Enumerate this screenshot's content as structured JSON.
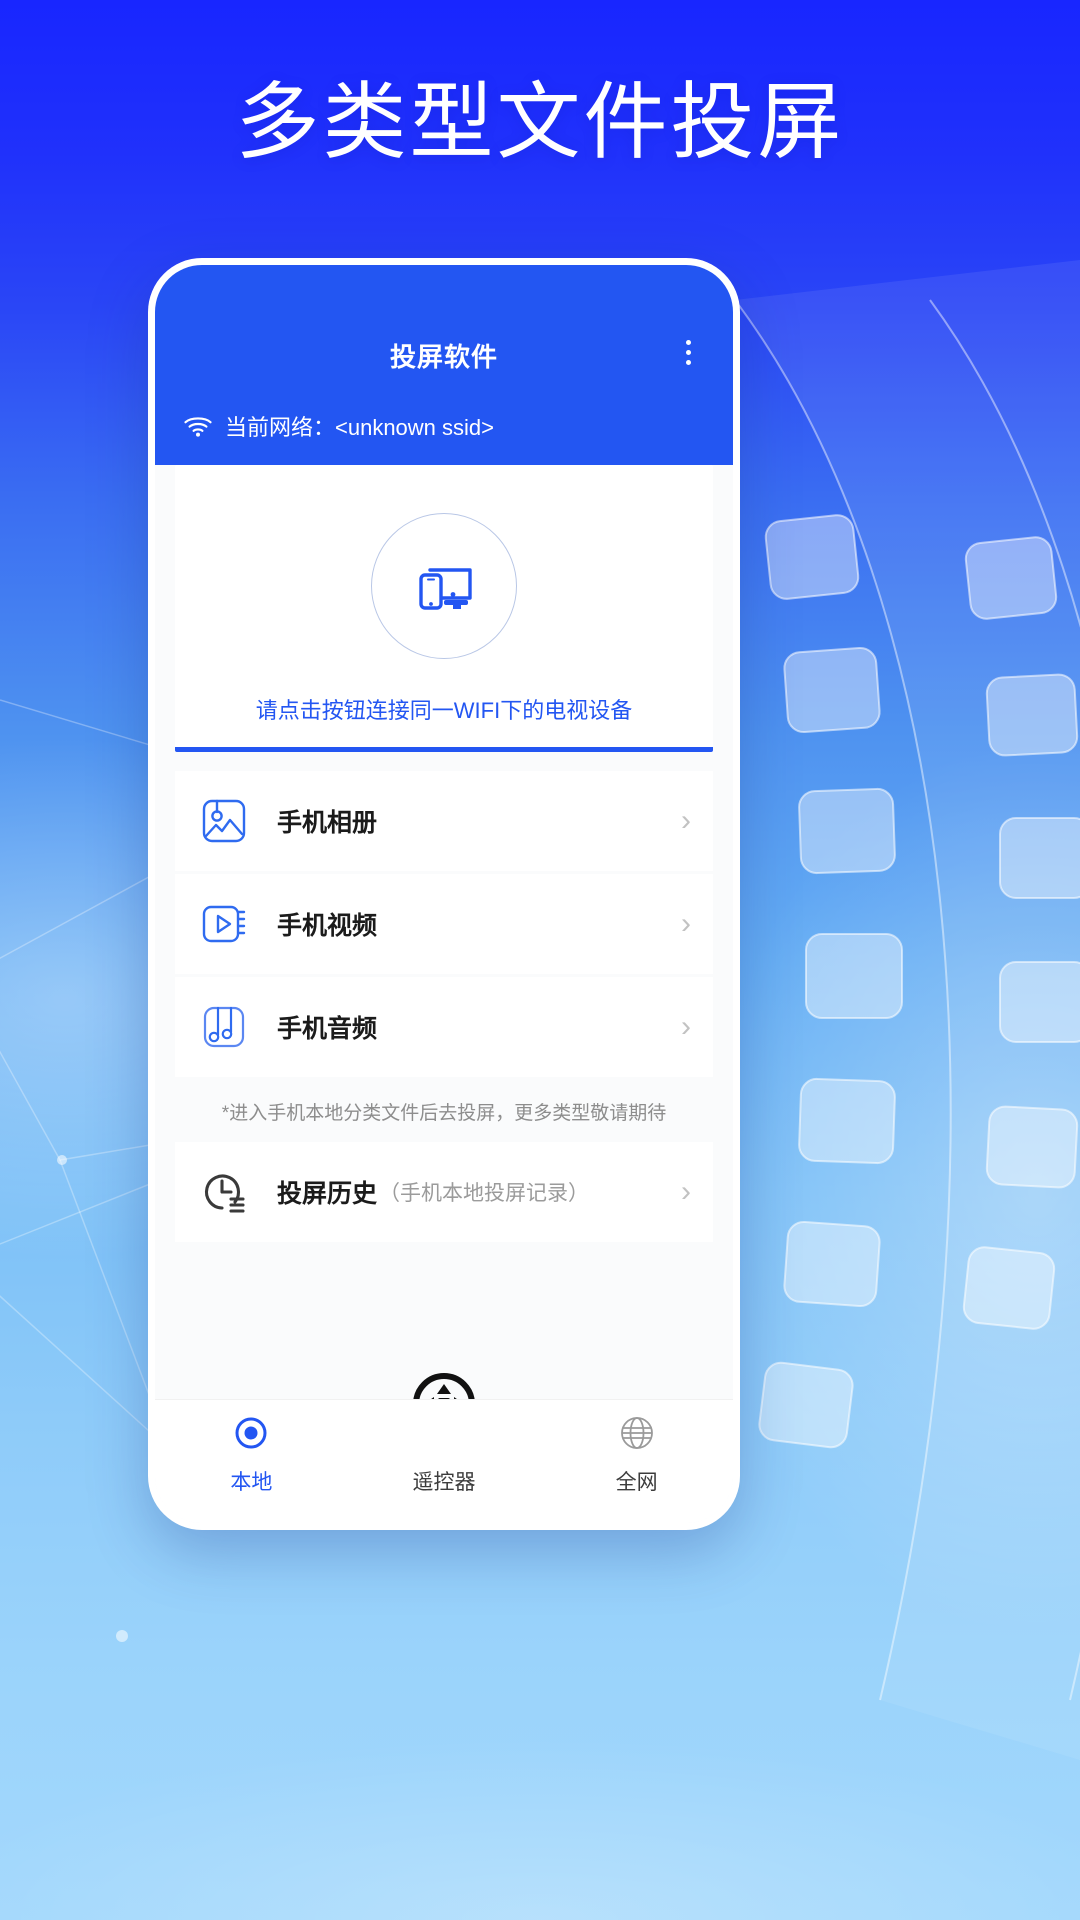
{
  "promo": {
    "headline": "多类型文件投屏",
    "bg_top_color": "#1826ff",
    "bg_bottom_color": "#a3d8fc"
  },
  "app": {
    "title": "投屏软件",
    "accent_color": "#2356f2",
    "header_bg": "#2356f2",
    "menu_icon": "kebab-menu-icon"
  },
  "network": {
    "icon": "wifi-icon",
    "label": "当前网络：",
    "ssid": "<unknown ssid>",
    "full_text": "当前网络：<unknown ssid>"
  },
  "connect": {
    "icon": "cast-devices-icon",
    "hint": "请点击按钮连接同一WIFI下的电视设备"
  },
  "categories": [
    {
      "icon": "photo-album-icon",
      "label": "手机相册",
      "chevron": "›"
    },
    {
      "icon": "video-play-icon",
      "label": "手机视频",
      "chevron": "›"
    },
    {
      "icon": "music-note-icon",
      "label": "手机音频",
      "chevron": "›"
    }
  ],
  "footnote": "*进入手机本地分类文件后去投屏，更多类型敬请期待",
  "history": {
    "icon": "clock-history-icon",
    "label": "投屏历史",
    "sub": "（手机本地投屏记录）",
    "chevron": "›"
  },
  "tabs": [
    {
      "icon": "target-dot-icon",
      "label": "本地",
      "active": true
    },
    {
      "icon": "dpad-remote-icon",
      "label": "遥控器",
      "active": false
    },
    {
      "icon": "globe-icon",
      "label": "全网",
      "active": false
    }
  ]
}
